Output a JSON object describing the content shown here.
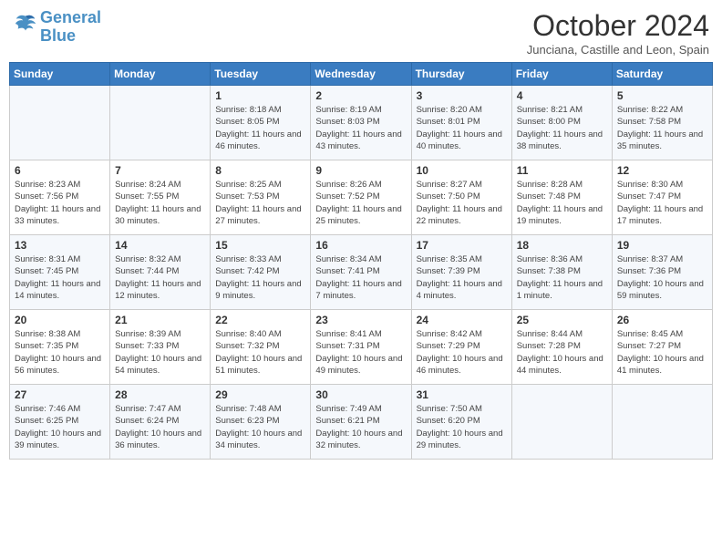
{
  "header": {
    "logo_line1": "General",
    "logo_line2": "Blue",
    "month_title": "October 2024",
    "subtitle": "Junciana, Castille and Leon, Spain"
  },
  "days_of_week": [
    "Sunday",
    "Monday",
    "Tuesday",
    "Wednesday",
    "Thursday",
    "Friday",
    "Saturday"
  ],
  "weeks": [
    [
      {
        "day": "",
        "info": ""
      },
      {
        "day": "",
        "info": ""
      },
      {
        "day": "1",
        "info": "Sunrise: 8:18 AM\nSunset: 8:05 PM\nDaylight: 11 hours and 46 minutes."
      },
      {
        "day": "2",
        "info": "Sunrise: 8:19 AM\nSunset: 8:03 PM\nDaylight: 11 hours and 43 minutes."
      },
      {
        "day": "3",
        "info": "Sunrise: 8:20 AM\nSunset: 8:01 PM\nDaylight: 11 hours and 40 minutes."
      },
      {
        "day": "4",
        "info": "Sunrise: 8:21 AM\nSunset: 8:00 PM\nDaylight: 11 hours and 38 minutes."
      },
      {
        "day": "5",
        "info": "Sunrise: 8:22 AM\nSunset: 7:58 PM\nDaylight: 11 hours and 35 minutes."
      }
    ],
    [
      {
        "day": "6",
        "info": "Sunrise: 8:23 AM\nSunset: 7:56 PM\nDaylight: 11 hours and 33 minutes."
      },
      {
        "day": "7",
        "info": "Sunrise: 8:24 AM\nSunset: 7:55 PM\nDaylight: 11 hours and 30 minutes."
      },
      {
        "day": "8",
        "info": "Sunrise: 8:25 AM\nSunset: 7:53 PM\nDaylight: 11 hours and 27 minutes."
      },
      {
        "day": "9",
        "info": "Sunrise: 8:26 AM\nSunset: 7:52 PM\nDaylight: 11 hours and 25 minutes."
      },
      {
        "day": "10",
        "info": "Sunrise: 8:27 AM\nSunset: 7:50 PM\nDaylight: 11 hours and 22 minutes."
      },
      {
        "day": "11",
        "info": "Sunrise: 8:28 AM\nSunset: 7:48 PM\nDaylight: 11 hours and 19 minutes."
      },
      {
        "day": "12",
        "info": "Sunrise: 8:30 AM\nSunset: 7:47 PM\nDaylight: 11 hours and 17 minutes."
      }
    ],
    [
      {
        "day": "13",
        "info": "Sunrise: 8:31 AM\nSunset: 7:45 PM\nDaylight: 11 hours and 14 minutes."
      },
      {
        "day": "14",
        "info": "Sunrise: 8:32 AM\nSunset: 7:44 PM\nDaylight: 11 hours and 12 minutes."
      },
      {
        "day": "15",
        "info": "Sunrise: 8:33 AM\nSunset: 7:42 PM\nDaylight: 11 hours and 9 minutes."
      },
      {
        "day": "16",
        "info": "Sunrise: 8:34 AM\nSunset: 7:41 PM\nDaylight: 11 hours and 7 minutes."
      },
      {
        "day": "17",
        "info": "Sunrise: 8:35 AM\nSunset: 7:39 PM\nDaylight: 11 hours and 4 minutes."
      },
      {
        "day": "18",
        "info": "Sunrise: 8:36 AM\nSunset: 7:38 PM\nDaylight: 11 hours and 1 minute."
      },
      {
        "day": "19",
        "info": "Sunrise: 8:37 AM\nSunset: 7:36 PM\nDaylight: 10 hours and 59 minutes."
      }
    ],
    [
      {
        "day": "20",
        "info": "Sunrise: 8:38 AM\nSunset: 7:35 PM\nDaylight: 10 hours and 56 minutes."
      },
      {
        "day": "21",
        "info": "Sunrise: 8:39 AM\nSunset: 7:33 PM\nDaylight: 10 hours and 54 minutes."
      },
      {
        "day": "22",
        "info": "Sunrise: 8:40 AM\nSunset: 7:32 PM\nDaylight: 10 hours and 51 minutes."
      },
      {
        "day": "23",
        "info": "Sunrise: 8:41 AM\nSunset: 7:31 PM\nDaylight: 10 hours and 49 minutes."
      },
      {
        "day": "24",
        "info": "Sunrise: 8:42 AM\nSunset: 7:29 PM\nDaylight: 10 hours and 46 minutes."
      },
      {
        "day": "25",
        "info": "Sunrise: 8:44 AM\nSunset: 7:28 PM\nDaylight: 10 hours and 44 minutes."
      },
      {
        "day": "26",
        "info": "Sunrise: 8:45 AM\nSunset: 7:27 PM\nDaylight: 10 hours and 41 minutes."
      }
    ],
    [
      {
        "day": "27",
        "info": "Sunrise: 7:46 AM\nSunset: 6:25 PM\nDaylight: 10 hours and 39 minutes."
      },
      {
        "day": "28",
        "info": "Sunrise: 7:47 AM\nSunset: 6:24 PM\nDaylight: 10 hours and 36 minutes."
      },
      {
        "day": "29",
        "info": "Sunrise: 7:48 AM\nSunset: 6:23 PM\nDaylight: 10 hours and 34 minutes."
      },
      {
        "day": "30",
        "info": "Sunrise: 7:49 AM\nSunset: 6:21 PM\nDaylight: 10 hours and 32 minutes."
      },
      {
        "day": "31",
        "info": "Sunrise: 7:50 AM\nSunset: 6:20 PM\nDaylight: 10 hours and 29 minutes."
      },
      {
        "day": "",
        "info": ""
      },
      {
        "day": "",
        "info": ""
      }
    ]
  ]
}
